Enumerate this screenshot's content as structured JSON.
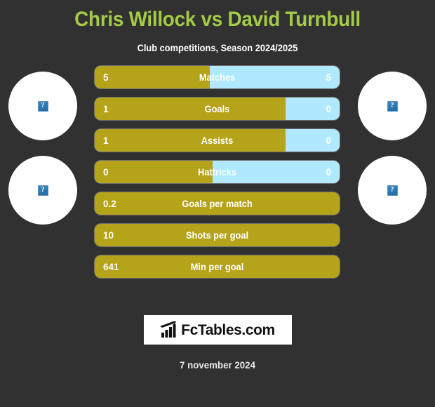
{
  "header": {
    "title": "Chris Willock vs David Turnbull",
    "subtitle": "Club competitions, Season 2024/2025",
    "title_color": "#a3cb46"
  },
  "players": {
    "left": {
      "photo_alt": "?",
      "club_logo_alt": "?"
    },
    "right": {
      "photo_alt": "?",
      "club_logo_alt": "?"
    }
  },
  "colors": {
    "background": "#313131",
    "left_bar": "#b5a319",
    "right_bar": "#b0e9fd",
    "accent_green": "#a3cb46"
  },
  "chart_data": {
    "type": "bar",
    "title": "Chris Willock vs David Turnbull",
    "subtitle": "Club competitions, Season 2024/2025",
    "categories": [
      "Matches",
      "Goals",
      "Assists",
      "Hattricks",
      "Goals per match",
      "Shots per goal",
      "Min per goal"
    ],
    "series": [
      {
        "name": "Chris Willock",
        "values": [
          "5",
          "1",
          "1",
          "0",
          "0.2",
          "10",
          "641"
        ]
      },
      {
        "name": "David Turnbull",
        "values": [
          "5",
          "0",
          "0",
          "0",
          "",
          "",
          ""
        ]
      }
    ],
    "legend": "none",
    "grid": false
  },
  "stats": [
    {
      "label": "Matches",
      "left": "5",
      "right": "5",
      "fill_pct": 47,
      "split": true
    },
    {
      "label": "Goals",
      "left": "1",
      "right": "0",
      "fill_pct": 78,
      "split": true
    },
    {
      "label": "Assists",
      "left": "1",
      "right": "0",
      "fill_pct": 78,
      "split": true
    },
    {
      "label": "Hattricks",
      "left": "0",
      "right": "0",
      "fill_pct": 48,
      "split": true
    },
    {
      "label": "Goals per match",
      "left": "0.2",
      "right": "",
      "fill_pct": 100,
      "split": false
    },
    {
      "label": "Shots per goal",
      "left": "10",
      "right": "",
      "fill_pct": 100,
      "split": false
    },
    {
      "label": "Min per goal",
      "left": "641",
      "right": "",
      "fill_pct": 100,
      "split": false
    }
  ],
  "footer": {
    "logo_text": "FcTables.com",
    "logo_icon": "bar-chart-arrow-icon",
    "date": "7 november 2024"
  }
}
